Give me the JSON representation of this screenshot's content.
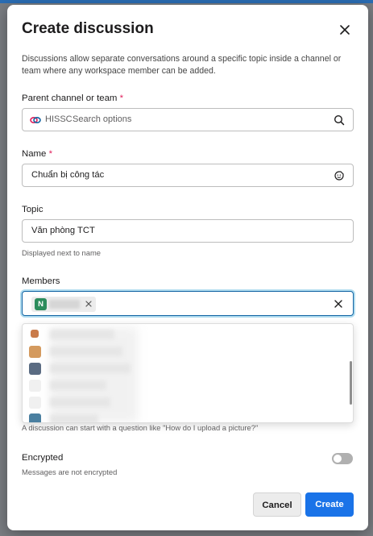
{
  "modal": {
    "title": "Create discussion",
    "description": "Discussions allow separate conversations around a specific topic inside a channel or team where any workspace member can be added."
  },
  "parent": {
    "label": "Parent channel or team",
    "required_mark": "*",
    "prefix": "HISSC",
    "placeholder": "Search options"
  },
  "name": {
    "label": "Name",
    "required_mark": "*",
    "value": "Chuẩn bị công tác"
  },
  "topic": {
    "label": "Topic",
    "value": "Văn phòng TCT",
    "hint": "Displayed next to name"
  },
  "members": {
    "label": "Members",
    "chips": [
      {
        "avatar_letter": "N",
        "avatar_color": "#2c8c5c"
      }
    ],
    "dropdown_avatar_colors": [
      "#c97b4a",
      "#d49a5e",
      "#5a6b82",
      "#f0f0f0",
      "#f0f0f0",
      "#4a7fa0"
    ]
  },
  "message_hint": "A discussion can start with a question like \"How do I upload a picture?\"",
  "encrypted": {
    "label": "Encrypted",
    "hint": "Messages are not encrypted",
    "on": false
  },
  "buttons": {
    "cancel": "Cancel",
    "create": "Create"
  },
  "colors": {
    "accent": "#1a73e8",
    "required": "#e01e5a"
  }
}
